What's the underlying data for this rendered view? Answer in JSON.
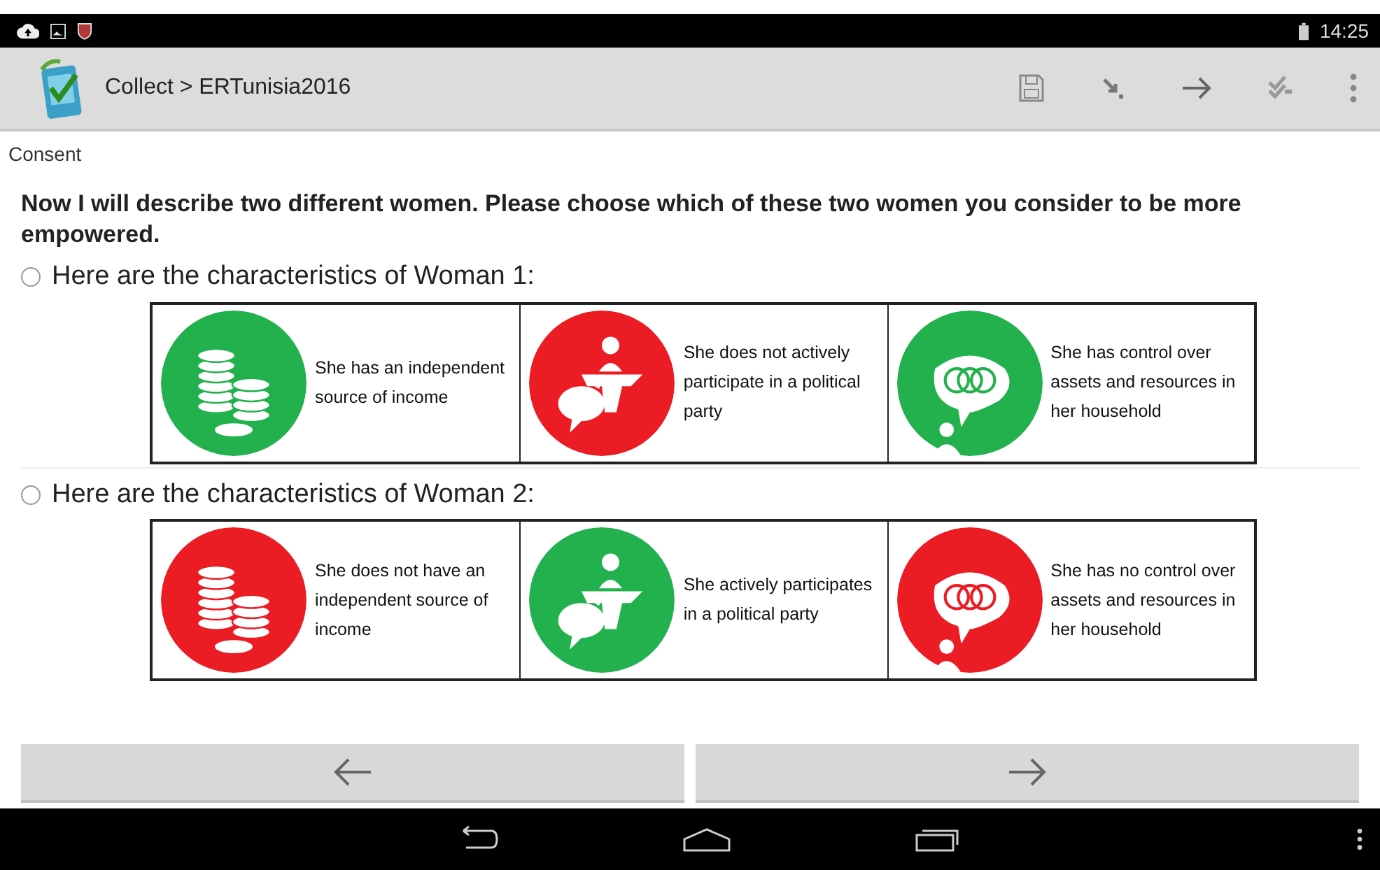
{
  "status_bar": {
    "time": "14:25"
  },
  "toolbar": {
    "title": "Collect > ERTunisia2016"
  },
  "section": "Consent",
  "question": "Now I will describe two different women. Please choose which of these two women you consider to be more empowered.",
  "options": [
    {
      "label": "Here are the characteristics of Woman 1:",
      "selected": false,
      "cells": [
        {
          "kind": "coins",
          "color": "#22b14c",
          "text": "She has an independent source of income"
        },
        {
          "kind": "podium",
          "color": "#ec1c24",
          "text": "She does not actively participate in a political party"
        },
        {
          "kind": "assets",
          "color": "#22b14c",
          "text": "She has control over assets and resources in her household"
        }
      ]
    },
    {
      "label": "Here are the characteristics of Woman 2:",
      "selected": false,
      "cells": [
        {
          "kind": "coins",
          "color": "#ec1c24",
          "text": "She does not have an independent source of income"
        },
        {
          "kind": "podium",
          "color": "#22b14c",
          "text": "She actively participates in a political party"
        },
        {
          "kind": "assets",
          "color": "#ec1c24",
          "text": "She has no control over assets and resources in her household"
        }
      ]
    }
  ]
}
